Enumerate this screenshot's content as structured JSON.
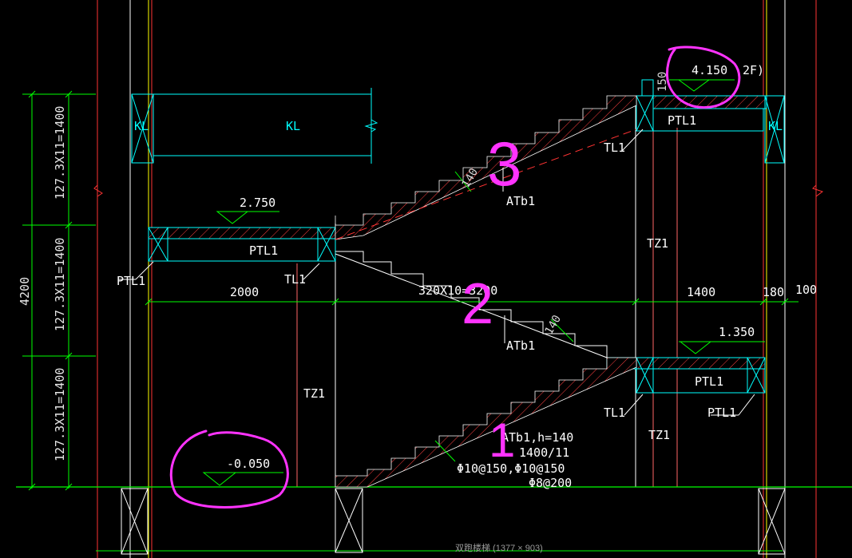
{
  "drawing": {
    "caption": "双跑楼梯 (1377 × 903)",
    "colors": {
      "background": "#000000",
      "beam": "#00ffff",
      "dimension": "#00ff00",
      "column": "#ff3333",
      "axis": "#ffff00",
      "hatch": "#ff4040",
      "text": "#ffffff",
      "markup": "#ff33ff"
    },
    "elevations": {
      "top": "4.150",
      "top_floor": "2F)",
      "mid_upper": "2.750",
      "mid_lower": "1.350",
      "ground": "-0.050"
    },
    "beams": {
      "kl_center": "KL",
      "kl_left": "KL",
      "kl_right": "KL",
      "ptl_top": "PTL1",
      "ptl_mid_left": "PTL1",
      "ptl_mid_right": "PTL1",
      "ptl_tag_left": "PTL1",
      "ptl_tag_right": "PTL1",
      "tl_top": "TL1",
      "tl_mid": "TL1",
      "tl_bottom": "TL1"
    },
    "columns": {
      "tz_right_upper": "TZ1",
      "tz_left": "TZ1",
      "tz_right_lower": "TZ1"
    },
    "flights": {
      "upper": "ATb1",
      "middle": "ATb1",
      "lower": "ATb1,h=140",
      "lower_steps": "1400/11",
      "rebar_main": "Φ10@150,Φ10@150",
      "rebar_dist": "Φ8@200",
      "slab_thickness": "140",
      "slab_thickness_mid": "140"
    },
    "dimensions": {
      "total_height": "4200",
      "riser_top": "127.3X11=1400",
      "riser_mid": "127.3X11=1400",
      "riser_bottom": "127.3X11=1400",
      "landing_left": "2000",
      "run": "320X10=3200",
      "landing_right": "1400",
      "wall": "180",
      "edge": "100",
      "top_small": "150"
    },
    "annotations": {
      "mark_1": "1",
      "mark_2": "2",
      "mark_3": "3"
    }
  }
}
